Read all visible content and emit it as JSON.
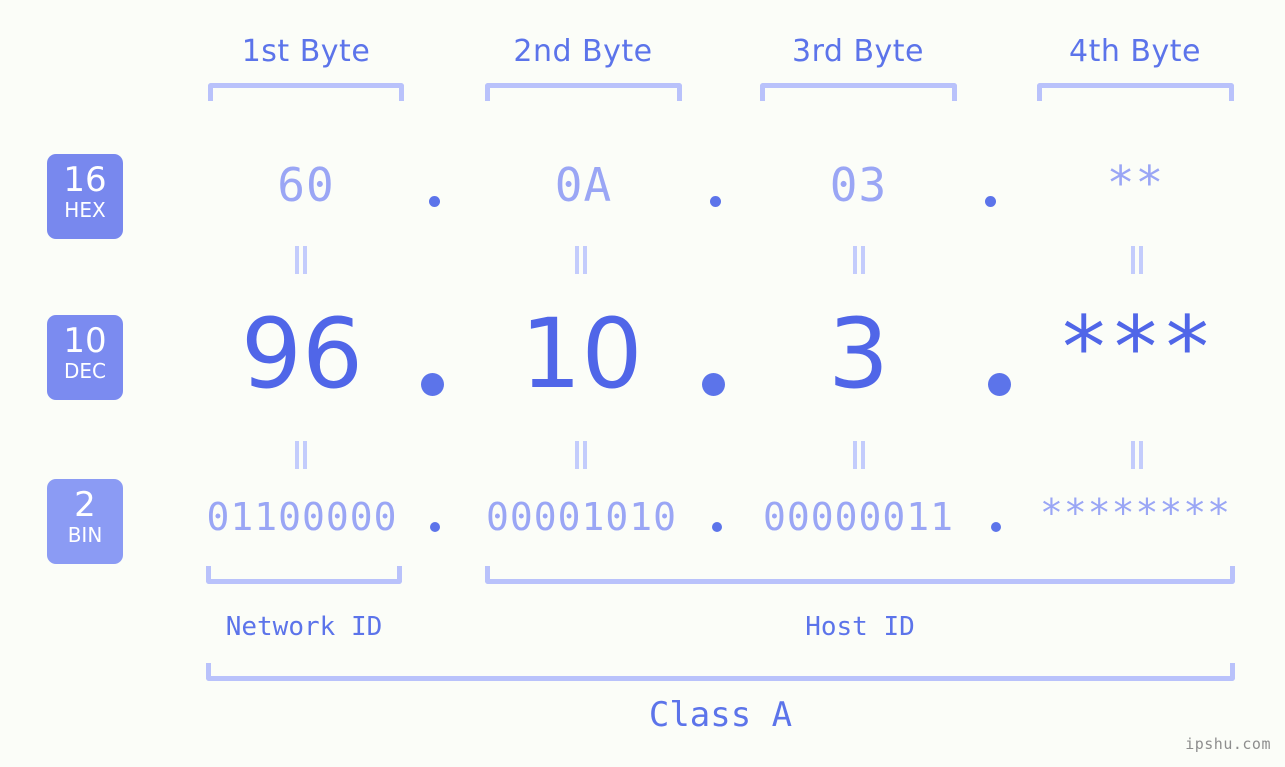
{
  "watermark": "ipshu.com",
  "colors": {
    "background": "#fbfdf8",
    "accent_strong": "#5066e8",
    "accent_label": "#5c74ea",
    "accent_light": "#9aa6f5",
    "bracket": "#b9c2fb",
    "badge_hex": "#7888ee",
    "badge_dec": "#7b8bf0",
    "badge_bin": "#8b9bf4",
    "watermark_color": "#8e8e8e"
  },
  "byte_headers": [
    {
      "label": "1st Byte"
    },
    {
      "label": "2nd Byte"
    },
    {
      "label": "3rd Byte"
    },
    {
      "label": "4th Byte"
    }
  ],
  "bases": [
    {
      "number": "16",
      "name": "HEX"
    },
    {
      "number": "10",
      "name": "DEC"
    },
    {
      "number": "2",
      "name": "BIN"
    }
  ],
  "rows": {
    "hex": {
      "base_number": "16",
      "base_name": "HEX",
      "values": [
        "60",
        "0A",
        "03",
        "**"
      ],
      "separators": [
        ".",
        ".",
        "."
      ]
    },
    "dec": {
      "base_number": "10",
      "base_name": "DEC",
      "values": [
        "96",
        "10",
        "3",
        "***"
      ],
      "separators": [
        ".",
        ".",
        "."
      ]
    },
    "bin": {
      "base_number": "2",
      "base_name": "BIN",
      "values": [
        "01100000",
        "00001010",
        "00000011",
        "********"
      ],
      "separators": [
        ".",
        ".",
        "."
      ]
    }
  },
  "equals": {
    "glyph": "=",
    "hex_to_dec": [
      "=",
      "=",
      "=",
      "="
    ],
    "dec_to_bin": [
      "=",
      "=",
      "=",
      "="
    ]
  },
  "sections": [
    {
      "label": "Network ID"
    },
    {
      "label": "Host ID"
    }
  ],
  "class_label": "Class A"
}
